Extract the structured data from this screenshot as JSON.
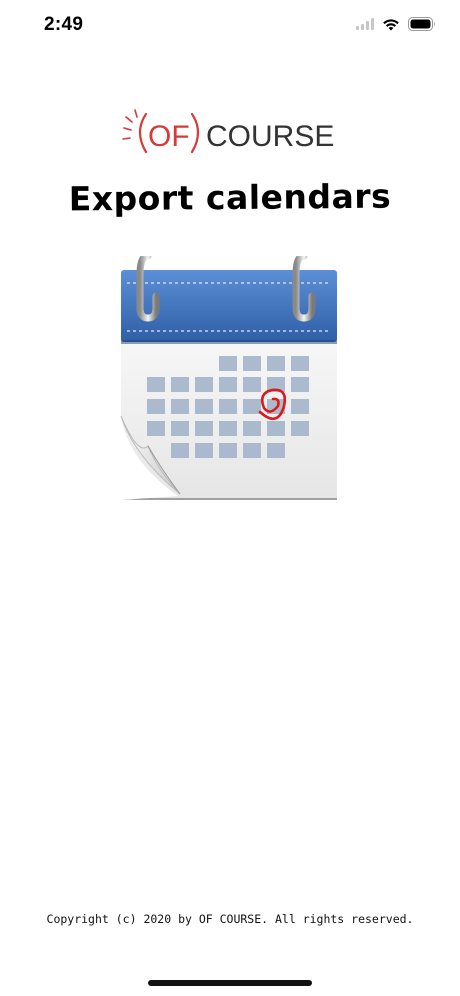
{
  "status_bar": {
    "time": "2:49",
    "icons": [
      "cellular-signal-icon",
      "wifi-icon",
      "battery-icon"
    ]
  },
  "logo": {
    "text_of": "OF",
    "text_course": "COURSE",
    "accent_color": "#d63a3a",
    "text_color": "#333333"
  },
  "page": {
    "title": "Export calendars"
  },
  "illustration": {
    "icon": "calendar-icon",
    "header_color": "#3a6fb8",
    "circle_color": "#d81b1b"
  },
  "footer": {
    "copyright": "Copyright (c) 2020 by OF COURSE. All rights reserved."
  }
}
